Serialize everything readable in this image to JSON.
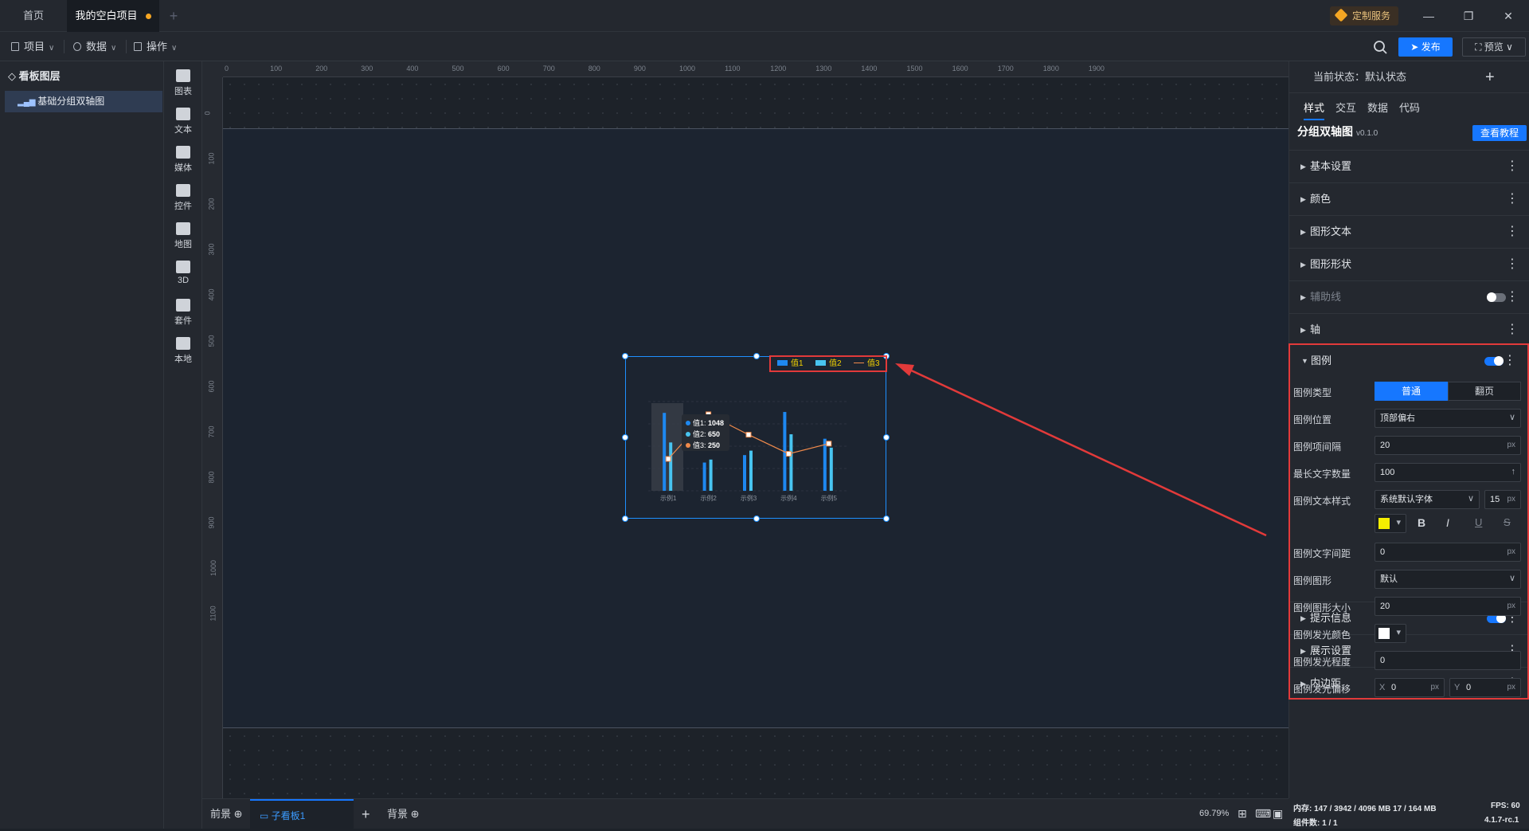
{
  "tabs": {
    "home": "首页",
    "project": "我的空白项目",
    "add": "+"
  },
  "header": {
    "custom_service": "定制服务"
  },
  "menu": {
    "project": "项目",
    "data": "数据",
    "operate": "操作",
    "publish": "发布",
    "preview": "预览"
  },
  "layers": {
    "title": "看板图层",
    "item": "基础分组双轴图"
  },
  "toolbox": [
    "图表",
    "文本",
    "媒体",
    "控件",
    "地图",
    "3D",
    "套件",
    "本地"
  ],
  "ruler": {
    "top": [
      "0",
      "100",
      "200",
      "300",
      "400",
      "500",
      "600",
      "700",
      "800",
      "900",
      "1000",
      "1100",
      "1200",
      "1300",
      "1400",
      "1500",
      "1600",
      "1700",
      "1800",
      "1900"
    ],
    "left": [
      "0",
      "100",
      "200",
      "300",
      "400",
      "500",
      "600",
      "700",
      "800",
      "900",
      "1000",
      "1100"
    ]
  },
  "chart": {
    "legend": [
      "值1",
      "值2",
      "值3"
    ],
    "categories": [
      "示例1",
      "示例2",
      "示例3",
      "示例4",
      "示例5"
    ],
    "tooltip": [
      {
        "name": "值1:",
        "value": "1048"
      },
      {
        "name": "值2:",
        "value": "650"
      },
      {
        "name": "值3:",
        "value": "250"
      }
    ],
    "colors": {
      "s1": "#1e88f0",
      "s2": "#48c4f0",
      "s3": "#f08a4b"
    }
  },
  "chart_data": {
    "type": "bar",
    "categories": [
      "示例1",
      "示例2",
      "示例3",
      "示例4",
      "示例5"
    ],
    "series": [
      {
        "name": "值1",
        "type": "bar",
        "values": [
          1048,
          380,
          480,
          1060,
          700
        ]
      },
      {
        "name": "值2",
        "type": "bar",
        "values": [
          650,
          420,
          540,
          760,
          580
        ]
      },
      {
        "name": "值3",
        "type": "line",
        "values": [
          250,
          600,
          440,
          290,
          370
        ]
      }
    ],
    "legend_position": "top-right"
  },
  "panel": {
    "state_label": "当前状态：",
    "state_value": "默认状态",
    "tabs": [
      "样式",
      "交互",
      "数据",
      "代码"
    ],
    "component": "分组双轴图",
    "version": "v0.1.0",
    "tutorial": "查看教程",
    "sections_top": [
      "基本设置",
      "颜色",
      "图形文本",
      "图形形状",
      "辅助线",
      "轴"
    ],
    "legend_section": "图例",
    "sections_bottom": [
      "提示信息",
      "展示设置",
      "内边距"
    ],
    "legend": {
      "type_label": "图例类型",
      "type_opt1": "普通",
      "type_opt2": "翻页",
      "position_label": "图例位置",
      "position_value": "顶部偏右",
      "gap_label": "图例项间隔",
      "gap_value": "20",
      "maxtext_label": "最长文字数量",
      "maxtext_value": "100",
      "textstyle_label": "图例文本样式",
      "font_value": "系统默认字体",
      "font_size": "15",
      "text_color": "#f5ee00",
      "textgap_label": "图例文字间距",
      "textgap_value": "0",
      "shape_label": "图例图形",
      "shape_value": "默认",
      "shapesize_label": "图例图形大小",
      "shapesize_value": "20",
      "glowcolor_label": "图例发光颜色",
      "glow_color": "#ffffff",
      "glowlevel_label": "图例发光程度",
      "glowlevel_value": "0",
      "glowoffset_label": "图例发光偏移",
      "offset_x_label": "X",
      "offset_x": "0",
      "offset_y_label": "Y",
      "offset_y": "0",
      "unit": "px"
    }
  },
  "statusbar": {
    "front": "前景",
    "child": "子看板1",
    "back": "背景",
    "zoom": "69.79%"
  },
  "memory": {
    "line1": "内存:  147 / 3942 / 4096 MB  17 / 164 MB",
    "fps": "FPS:  60",
    "line2": "组件数: 1 / 1",
    "version": "4.1.7-rc.1"
  }
}
